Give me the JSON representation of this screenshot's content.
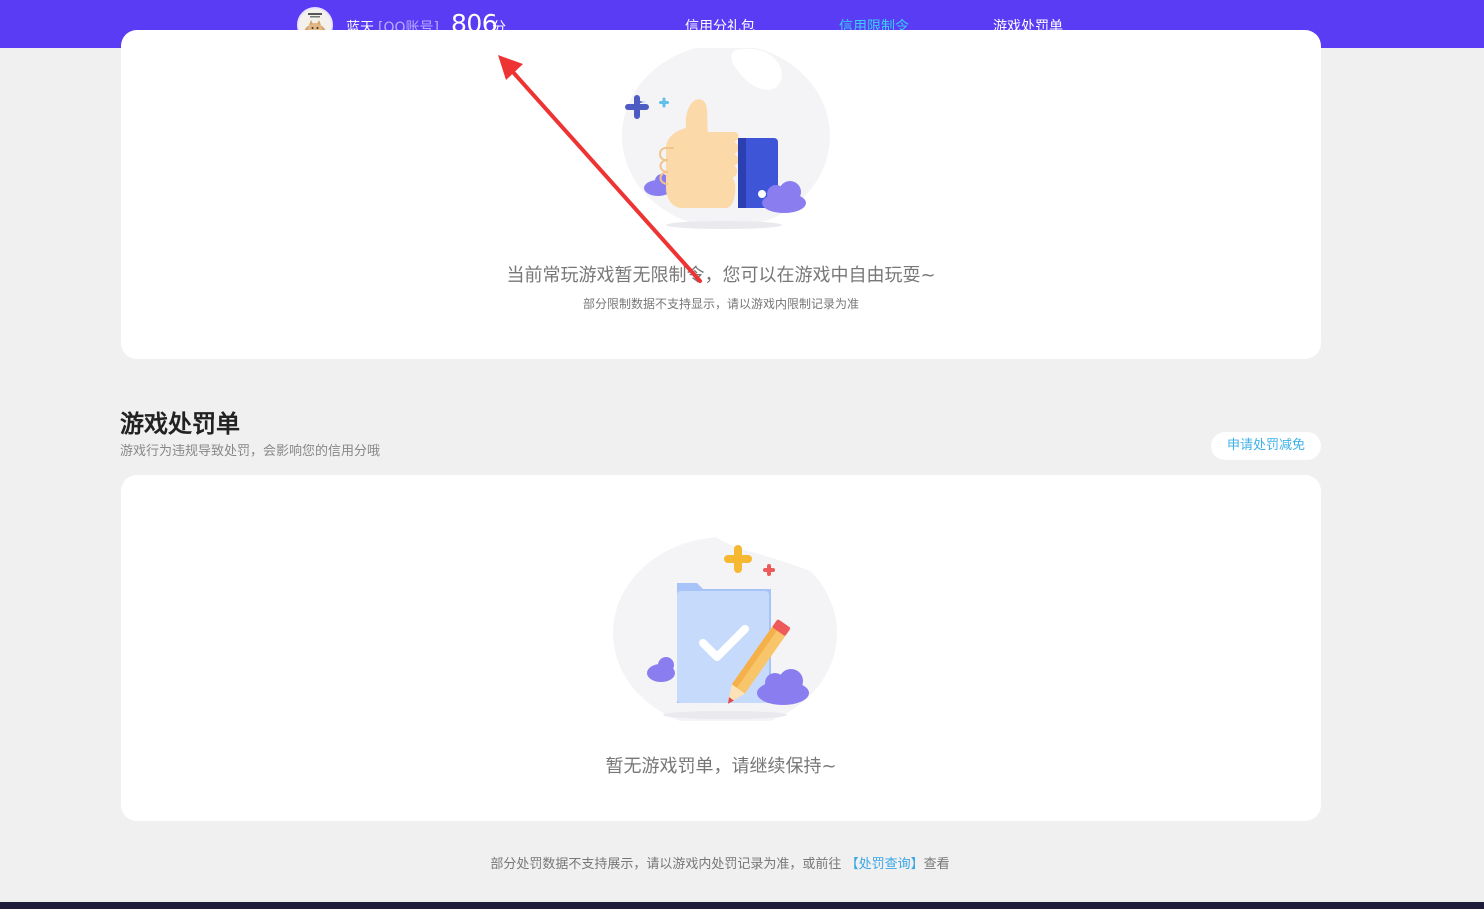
{
  "header": {
    "user_name": "蓝天",
    "account_type": "[QQ账号]",
    "score": "806",
    "score_unit": "分",
    "tabs": [
      {
        "label": "信用分礼包",
        "active": false
      },
      {
        "label": "信用限制令",
        "active": true
      },
      {
        "label": "游戏处罚单",
        "active": false
      }
    ],
    "bar_color": "#5a3cf5",
    "active_tab_color": "#36d0f5"
  },
  "restriction": {
    "empty_title": "当前常玩游戏暂无限制令，您可以在游戏中自由玩耍~",
    "empty_note": "部分限制数据不支持显示，请以游戏内限制记录为准",
    "illustration": "thumbs-up-icon"
  },
  "penalty": {
    "title": "游戏处罚单",
    "subtitle": "游戏行为违规导致处罚，会影响您的信用分哦",
    "appeal_button": "申请处罚减免",
    "empty_title": "暂无游戏罚单，请继续保持~",
    "illustration": "checklist-pencil-icon"
  },
  "footer": {
    "note_prefix": "部分处罚数据不支持展示，请以游戏内处罚记录为准，或前往",
    "link_text": "【处罚查询】",
    "note_suffix": "查看"
  },
  "annotation": {
    "arrow_color": "#ee3333"
  }
}
